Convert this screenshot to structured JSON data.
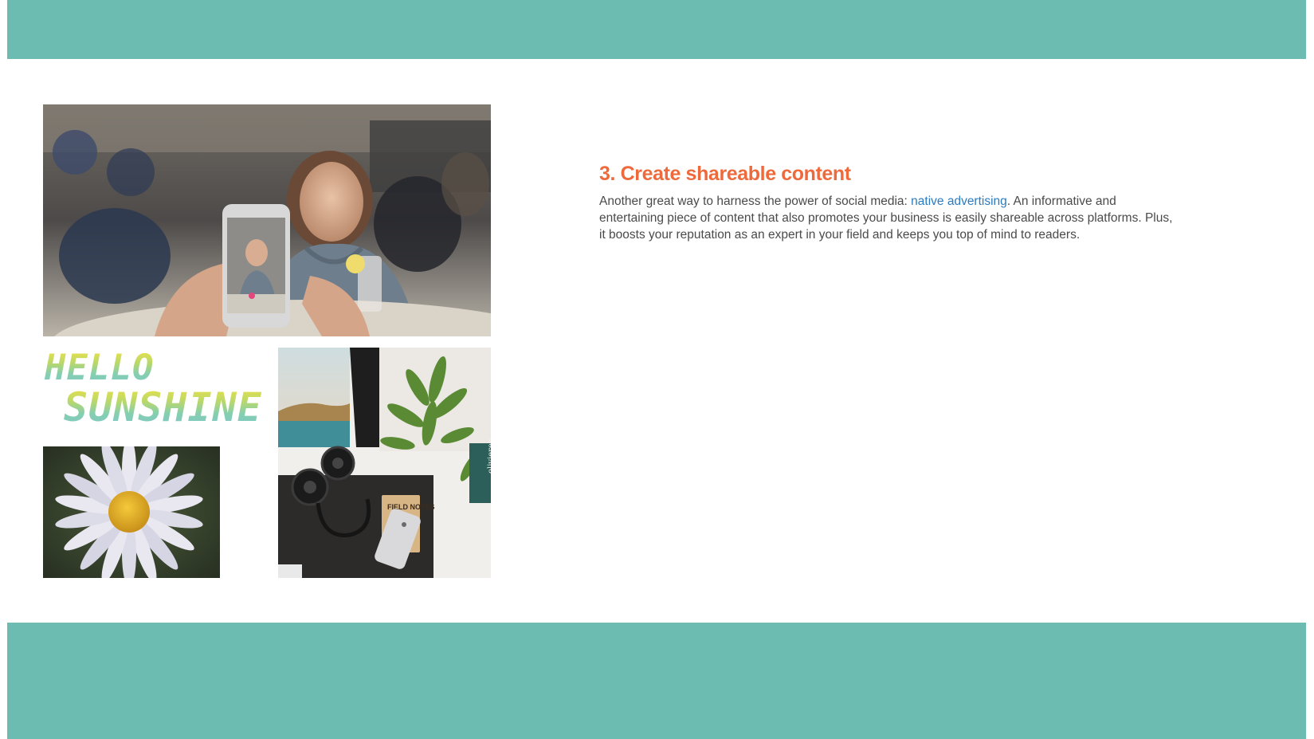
{
  "colors": {
    "band": "#6cbcb1",
    "heading": "#ee6a3c",
    "body_text": "#4a4a4a",
    "link": "#2b7bbf"
  },
  "images": {
    "selfie": "selfie-photo",
    "hello": "hello-sunshine-graphic",
    "daisy": "daisy-photo",
    "desk": "desk-flatlay-photo"
  },
  "graphic": {
    "line1": "HELLO",
    "line2": "SUNSHINE!"
  },
  "desk_photo": {
    "notebook_label": "FIELD NOTES",
    "book_spine": "olivieren"
  },
  "article": {
    "heading": "3. Create shareable content",
    "body_before_link": "Another great way to harness the power of social media: ",
    "link_text": "native advertising",
    "body_after_link": ". An informative and entertaining piece of content that also promotes your business is easily shareable across platforms. Plus, it boosts your reputation as an expert in your field and keeps you top of mind to readers."
  }
}
